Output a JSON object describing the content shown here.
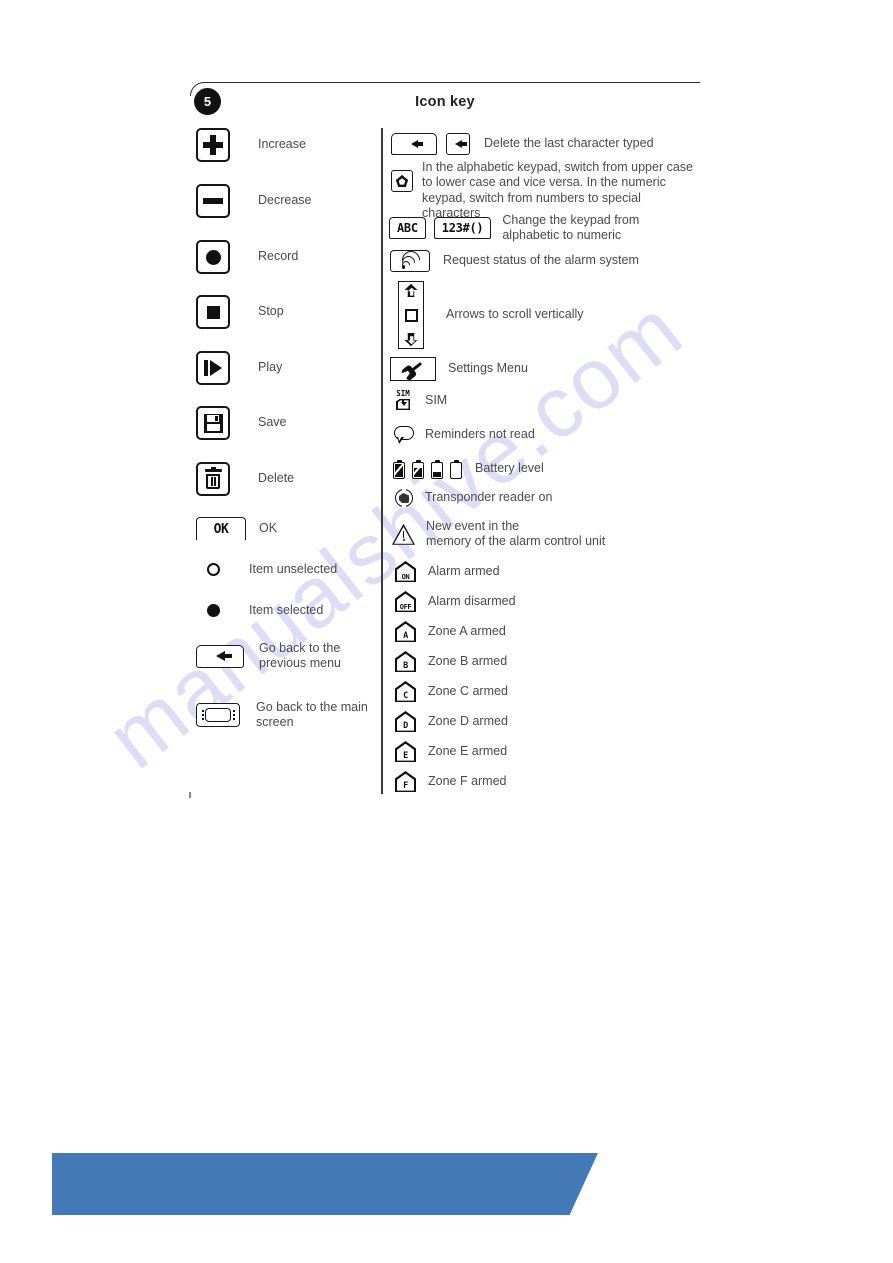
{
  "page": {
    "section_number": "5",
    "title": "Icon key",
    "stray_mark": ""
  },
  "watermark": {
    "text": "manualshive.com",
    "color": "#c9c9ef"
  },
  "theme": {
    "ink": "#161616",
    "label_text": "#4a4a50",
    "banner_blue": "#4479b8",
    "badge_bg": "#111111"
  },
  "left_column": [
    {
      "icon": "plus-key-icon",
      "label": "Increase"
    },
    {
      "icon": "minus-key-icon",
      "label": "Decrease"
    },
    {
      "icon": "record-key-icon",
      "label": "Record"
    },
    {
      "icon": "stop-key-icon",
      "label": "Stop"
    },
    {
      "icon": "play-key-icon",
      "label": "Play"
    },
    {
      "icon": "save-floppy-key-icon",
      "label": "Save"
    },
    {
      "icon": "delete-trash-key-icon",
      "label": "Delete"
    },
    {
      "icon": "ok-key-icon",
      "label": "OK",
      "key_text": "OK"
    },
    {
      "icon": "radio-unselected-icon",
      "label": "Item unselected"
    },
    {
      "icon": "radio-selected-icon",
      "label": "Item selected"
    },
    {
      "icon": "back-arrow-key-icon",
      "label": "Go back to the\nprevious menu"
    },
    {
      "icon": "home-screen-key-icon",
      "label": "Go back to the main\nscreen"
    }
  ],
  "right_column": [
    {
      "icons": [
        "backspace-wide-key-icon",
        "backspace-small-key-icon"
      ],
      "label": "Delete the last character typed"
    },
    {
      "icons": [
        "shift-pentagon-key-icon"
      ],
      "label": "In the alphabetic keypad, switch from upper case to lower case and vice versa. In the numeric keypad, switch from numbers to special characters"
    },
    {
      "icons": [
        "abc-key-icon",
        "numeric-key-icon"
      ],
      "key_texts": [
        "ABC",
        "123#()"
      ],
      "label": "Change the keypad from\nalphabetic to numeric"
    },
    {
      "icons": [
        "signal-status-key-icon"
      ],
      "label": "Request status of the alarm system"
    },
    {
      "icons": [
        "vertical-scroll-strip-icon"
      ],
      "label": "Arrows to scroll vertically"
    },
    {
      "icons": [
        "settings-wrench-key-icon"
      ],
      "label": "Settings Menu"
    },
    {
      "icons": [
        "sim-card-icon"
      ],
      "label": "SIM"
    },
    {
      "icons": [
        "reminder-bubble-icon"
      ],
      "label": "Reminders not read"
    },
    {
      "icons": [
        "battery-level-icons"
      ],
      "label": "Battery level"
    },
    {
      "icons": [
        "transponder-reader-icon"
      ],
      "label": "Transponder reader on"
    },
    {
      "icons": [
        "warning-triangle-icon"
      ],
      "label": "New event in the\nmemory of the alarm control unit"
    },
    {
      "icons": [
        "house-on-icon"
      ],
      "house_text": "ON",
      "label": "Alarm armed"
    },
    {
      "icons": [
        "house-off-icon"
      ],
      "house_text": "OFF",
      "label": "Alarm disarmed"
    },
    {
      "icons": [
        "house-a-icon"
      ],
      "house_text": "A",
      "label": "Zone A armed"
    },
    {
      "icons": [
        "house-b-icon"
      ],
      "house_text": "B",
      "label": "Zone B armed"
    },
    {
      "icons": [
        "house-c-icon"
      ],
      "house_text": "C",
      "label": "Zone C armed"
    },
    {
      "icons": [
        "house-d-icon"
      ],
      "house_text": "D",
      "label": "Zone D armed"
    },
    {
      "icons": [
        "house-e-icon"
      ],
      "house_text": "E",
      "label": "Zone E armed"
    },
    {
      "icons": [
        "house-f-icon"
      ],
      "house_text": "F",
      "label": "Zone F armed"
    }
  ]
}
